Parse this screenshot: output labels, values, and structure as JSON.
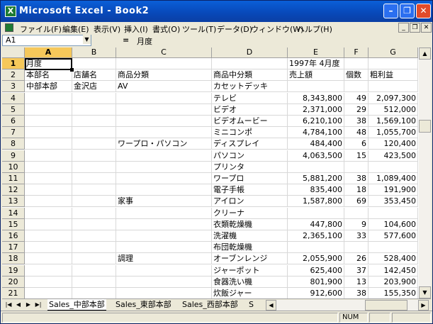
{
  "window": {
    "title": "Microsoft Excel - Book2",
    "app_icon": "X"
  },
  "menu": [
    "ファイル(F)",
    "編集(E)",
    "表示(V)",
    "挿入(I)",
    "書式(O)",
    "ツール(T)",
    "データ(D)",
    "ウィンドウ(W)",
    "ヘルプ(H)"
  ],
  "formula_bar": {
    "name_box": "A1",
    "equals": "=",
    "formula": "月度"
  },
  "columns": [
    "A",
    "B",
    "C",
    "D",
    "E",
    "F",
    "G"
  ],
  "rows": [
    "1",
    "2",
    "3",
    "4",
    "5",
    "6",
    "7",
    "8",
    "9",
    "10",
    "11",
    "12",
    "13",
    "14",
    "15",
    "16",
    "17",
    "18",
    "19",
    "20",
    "21"
  ],
  "cells": [
    [
      "月度",
      "",
      "",
      "",
      "1997年 4月度",
      "",
      ""
    ],
    [
      "本部名",
      "店舗名",
      "商品分類",
      "商品中分類",
      "売上額",
      "個数",
      "粗利益"
    ],
    [
      "中部本部",
      "金沢店",
      "AV",
      "カセットデッキ",
      "",
      "",
      ""
    ],
    [
      "",
      "",
      "",
      "テレビ",
      "8,343,800",
      "49",
      "2,097,300"
    ],
    [
      "",
      "",
      "",
      "ビデオ",
      "2,371,000",
      "29",
      "512,000"
    ],
    [
      "",
      "",
      "",
      "ビデオムービー",
      "6,210,100",
      "38",
      "1,569,100"
    ],
    [
      "",
      "",
      "",
      "ミニコンポ",
      "4,784,100",
      "48",
      "1,055,700"
    ],
    [
      "",
      "",
      "ワープロ・パソコン",
      "ディスプレイ",
      "484,400",
      "6",
      "120,400"
    ],
    [
      "",
      "",
      "",
      "パソコン",
      "4,063,500",
      "15",
      "423,500"
    ],
    [
      "",
      "",
      "",
      "プリンタ",
      "",
      "",
      ""
    ],
    [
      "",
      "",
      "",
      "ワープロ",
      "5,881,200",
      "38",
      "1,089,400"
    ],
    [
      "",
      "",
      "",
      "電子手帳",
      "835,400",
      "18",
      "191,900"
    ],
    [
      "",
      "",
      "家事",
      "アイロン",
      "1,587,800",
      "69",
      "353,450"
    ],
    [
      "",
      "",
      "",
      "クリーナ",
      "",
      "",
      ""
    ],
    [
      "",
      "",
      "",
      "衣類乾燥機",
      "447,800",
      "9",
      "104,600"
    ],
    [
      "",
      "",
      "",
      "洗濯機",
      "2,365,100",
      "33",
      "577,600"
    ],
    [
      "",
      "",
      "",
      "布団乾燥機",
      "",
      "",
      ""
    ],
    [
      "",
      "",
      "調理",
      "オーブンレンジ",
      "2,055,900",
      "26",
      "528,400"
    ],
    [
      "",
      "",
      "",
      "ジャーポット",
      "625,400",
      "37",
      "142,450"
    ],
    [
      "",
      "",
      "",
      "食器洗い機",
      "801,900",
      "13",
      "203,900"
    ],
    [
      "",
      "",
      "",
      "炊飯ジャー",
      "912,600",
      "38",
      "155,350"
    ]
  ],
  "sheet_tabs": [
    "Sales_中部本部",
    "Sales_東部本部",
    "Sales_西部本部",
    "S"
  ],
  "status": {
    "num": "NUM"
  }
}
